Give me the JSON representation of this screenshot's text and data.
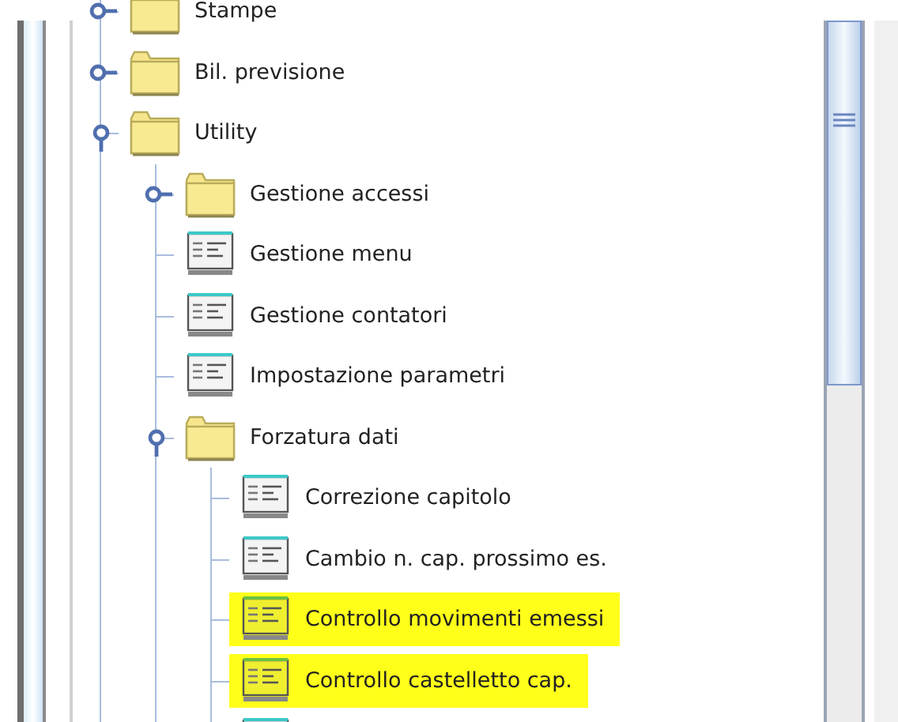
{
  "tree": [
    {
      "label": "Stampe",
      "kind": "folder",
      "expanded": false,
      "highlighted": false
    },
    {
      "label": "Bil. previsione",
      "kind": "folder",
      "expanded": false,
      "highlighted": false
    },
    {
      "label": "Utility",
      "kind": "folder",
      "expanded": true,
      "highlighted": false,
      "children": [
        {
          "label": "Gestione accessi",
          "kind": "folder",
          "expanded": false,
          "highlighted": false
        },
        {
          "label": "Gestione menu",
          "kind": "form",
          "highlighted": false
        },
        {
          "label": "Gestione contatori",
          "kind": "form",
          "highlighted": false
        },
        {
          "label": "Impostazione parametri",
          "kind": "form",
          "highlighted": false
        },
        {
          "label": "Forzatura dati",
          "kind": "folder",
          "expanded": true,
          "highlighted": false,
          "children": [
            {
              "label": "Correzione capitolo",
              "kind": "form",
              "highlighted": false
            },
            {
              "label": "Cambio n. cap. prossimo es.",
              "kind": "form",
              "highlighted": false
            },
            {
              "label": "Controllo movimenti emessi",
              "kind": "form",
              "highlighted": true
            },
            {
              "label": "Controllo castelletto cap.",
              "kind": "form",
              "highlighted": true
            },
            {
              "kind": "form",
              "highlighted": false
            }
          ]
        }
      ]
    }
  ]
}
